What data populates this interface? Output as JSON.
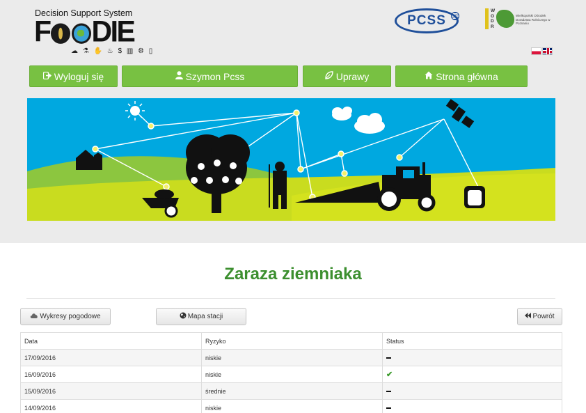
{
  "header": {
    "logo_tagline": "Decision Support System",
    "logo_name_start": "F",
    "logo_name_end": "DIE",
    "logo_icons": "☁ ⚗ ✋ ♨ $ ▥ ⚙ ▯",
    "partner_logo_1": "PCSS",
    "partner_logo_2_letters": "W O D R",
    "partner_logo_2_text": "Wielkopolski Ośrodek Doradztwa Rolniczego w Poznaniu"
  },
  "nav": {
    "logout": {
      "label": "Wyloguj się",
      "icon": "sign-out-icon"
    },
    "user": {
      "label": "Szymon Pcss",
      "icon": "user-icon"
    },
    "crops": {
      "label": "Uprawy",
      "icon": "leaf-icon"
    },
    "home": {
      "label": "Strona główna",
      "icon": "home-icon"
    }
  },
  "languages": [
    "pl",
    "en"
  ],
  "page": {
    "title": "Zaraza ziemniaka"
  },
  "toolbar": {
    "weather_charts": "Wykresy pogodowe",
    "station_map": "Mapa stacji",
    "back": "Powrót"
  },
  "table": {
    "headers": [
      "Data",
      "Ryzyko",
      "Status"
    ],
    "rows": [
      {
        "date": "17/09/2016",
        "risk": "niskie",
        "status": "dash"
      },
      {
        "date": "16/09/2016",
        "risk": "niskie",
        "status": "check"
      },
      {
        "date": "15/09/2016",
        "risk": "średnie",
        "status": "dash"
      },
      {
        "date": "14/09/2016",
        "risk": "niskie",
        "status": "dash"
      }
    ]
  },
  "colors": {
    "nav_green": "#78c142",
    "title_green": "#3c8f2f",
    "banner_sky": "#00a8e0",
    "banner_grass": "#c9dc1f"
  }
}
